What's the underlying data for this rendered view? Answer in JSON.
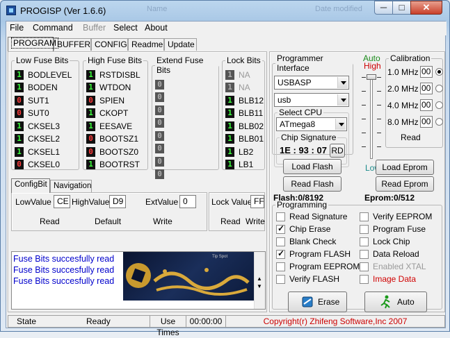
{
  "window": {
    "title": "PROGISP (Ver 1.6.6)",
    "ghost_left": "Name",
    "ghost_right": "Date modified",
    "buttons": {
      "minimize": "─",
      "maximize": "□",
      "close": "✕"
    }
  },
  "menu": [
    "File",
    "Command",
    "Buffer",
    "Select",
    "About"
  ],
  "tabs": [
    "PROGRAM",
    "BUFFER",
    "CONFIG",
    "Readme",
    "Update"
  ],
  "fuse_groups": {
    "low": {
      "title": "Low Fuse Bits",
      "bits": [
        {
          "v": "1",
          "name": "BODLEVEL"
        },
        {
          "v": "1",
          "name": "BODEN"
        },
        {
          "v": "0",
          "name": "SUT1"
        },
        {
          "v": "0",
          "name": "SUT0"
        },
        {
          "v": "1",
          "name": "CKSEL3"
        },
        {
          "v": "1",
          "name": "CKSEL2"
        },
        {
          "v": "1",
          "name": "CKSEL1"
        },
        {
          "v": "0",
          "name": "CKSEL0"
        }
      ]
    },
    "high": {
      "title": "High Fuse Bits",
      "bits": [
        {
          "v": "1",
          "name": "RSTDISBL"
        },
        {
          "v": "1",
          "name": "WTDON"
        },
        {
          "v": "0",
          "name": "SPIEN"
        },
        {
          "v": "1",
          "name": "CKOPT"
        },
        {
          "v": "1",
          "name": "EESAVE"
        },
        {
          "v": "0",
          "name": "BOOTSZ1"
        },
        {
          "v": "0",
          "name": "BOOTSZ0"
        },
        {
          "v": "1",
          "name": "BOOTRST"
        }
      ]
    },
    "extend": {
      "title": "Extend Fuse Bits",
      "bits": [
        {
          "v": "0",
          "name": ""
        },
        {
          "v": "0",
          "name": ""
        },
        {
          "v": "0",
          "name": ""
        },
        {
          "v": "0",
          "name": ""
        },
        {
          "v": "0",
          "name": ""
        },
        {
          "v": "0",
          "name": ""
        },
        {
          "v": "0",
          "name": ""
        },
        {
          "v": "0",
          "name": ""
        }
      ]
    },
    "lock": {
      "title": "Lock Bits",
      "bits": [
        {
          "v": "1",
          "name": "NA",
          "dis": true
        },
        {
          "v": "1",
          "name": "NA",
          "dis": true
        },
        {
          "v": "1",
          "name": "BLB12"
        },
        {
          "v": "1",
          "name": "BLB11"
        },
        {
          "v": "1",
          "name": "BLB02"
        },
        {
          "v": "1",
          "name": "BLB01"
        },
        {
          "v": "1",
          "name": "LB2"
        },
        {
          "v": "1",
          "name": "LB1"
        }
      ]
    }
  },
  "subtabs": [
    "ConfigBit",
    "Navigation"
  ],
  "values": {
    "low_label": "LowValue",
    "low": "CE",
    "high_label": "HighValue",
    "high": "D9",
    "ext_label": "ExtValue",
    "ext": "0",
    "lock_label": "Lock Value",
    "lock": "FF",
    "read": "Read",
    "default": "Default",
    "write": "Write",
    "lock_read": "Read",
    "lock_write": "Write"
  },
  "log": [
    "Fuse Bits succesfully read",
    "Fuse Bits succesfully read",
    "Fuse Bits succesfully read"
  ],
  "banner": {
    "line1": "Tip Spot",
    "line2": "Tip Spot"
  },
  "programmer": {
    "title": "Programmer Interface",
    "interface": "USBASP",
    "port": "usb",
    "cpu_title": "Select CPU",
    "cpu": "ATmega8",
    "sig_title": "Chip Signature",
    "signature": "1E : 93 : 07",
    "rd": "RD"
  },
  "auto": {
    "auto": "Auto",
    "high": "High",
    "low": "Low"
  },
  "calibration": {
    "title": "Calibration",
    "rows": [
      {
        "freq": "1.0 MHz",
        "val": "00",
        "sel": true
      },
      {
        "freq": "2.0 MHz",
        "val": "00",
        "sel": false
      },
      {
        "freq": "4.0 MHz",
        "val": "00",
        "sel": false
      },
      {
        "freq": "8.0 MHz",
        "val": "00",
        "sel": false
      }
    ],
    "read": "Read"
  },
  "buttons": {
    "load_flash": "Load Flash",
    "read_flash": "Read Flash",
    "load_eprom": "Load Eprom",
    "read_eprom": "Read Eprom",
    "erase": "Erase",
    "auto": "Auto"
  },
  "sizes": {
    "flash": "Flash:0/8192",
    "eprom": "Eprom:0/512"
  },
  "programming": {
    "title": "Programming",
    "left": [
      {
        "label": "Read Signature",
        "checked": false
      },
      {
        "label": "Chip Erase",
        "checked": true
      },
      {
        "label": "Blank Check",
        "checked": false
      },
      {
        "label": "Program FLASH",
        "checked": true
      },
      {
        "label": "Program EEPROM",
        "checked": false
      },
      {
        "label": "Verify FLASH",
        "checked": false
      }
    ],
    "right": [
      {
        "label": "Verify EEPROM",
        "checked": false
      },
      {
        "label": "Program Fuse",
        "checked": false
      },
      {
        "label": "Lock Chip",
        "checked": false
      },
      {
        "label": "Data Reload",
        "checked": false
      },
      {
        "label": "Enabled XTAL",
        "checked": false,
        "dis": true
      },
      {
        "label": "Image Data",
        "checked": false,
        "red": true
      }
    ]
  },
  "status": {
    "state_label": "State",
    "state": "Ready",
    "use_times": "Use Times",
    "time": "00:00:00",
    "copyright": "Copyright(r) Zhifeng Software,Inc 2007"
  },
  "colors": {
    "log_text": "#0000cc",
    "copyright": "#cc0000",
    "auto": "#1a8a1a",
    "high": "#cc0000",
    "low": "#1a8a8a"
  }
}
